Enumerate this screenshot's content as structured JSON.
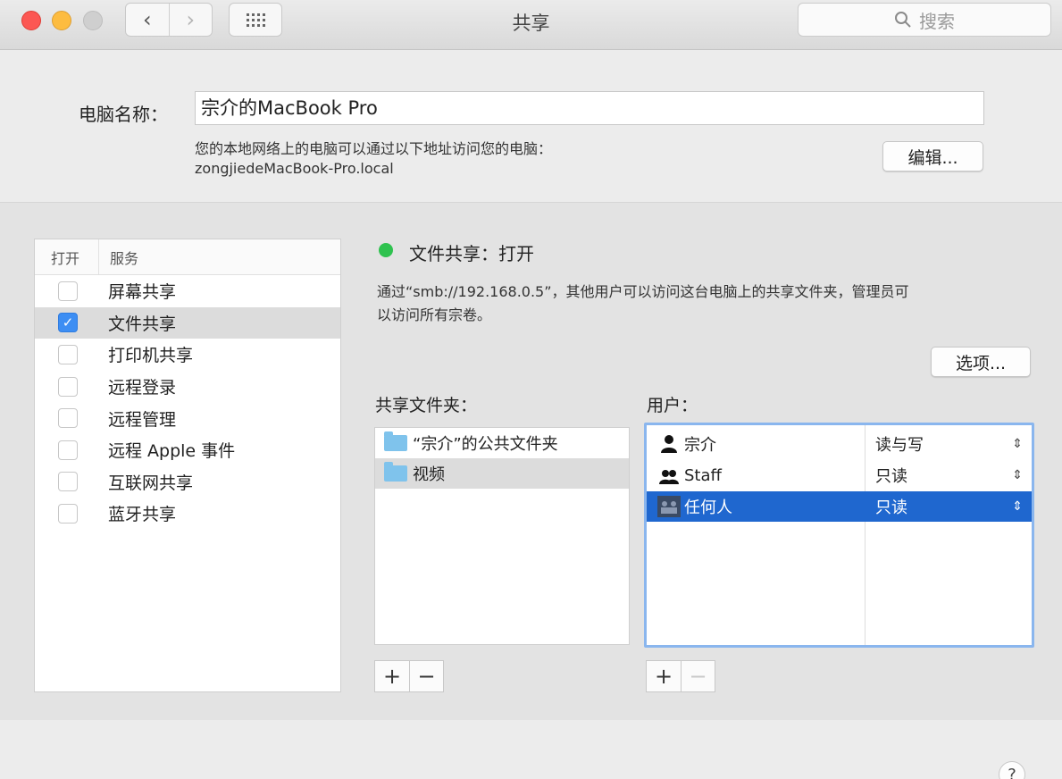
{
  "window": {
    "title": "共享"
  },
  "search": {
    "placeholder": "搜索"
  },
  "computer": {
    "label": "电脑名称：",
    "name": "宗介的MacBook Pro",
    "hint_line1": "您的本地网络上的电脑可以通过以下地址访问您的电脑：",
    "hint_line2": "zongjiedeMacBook-Pro.local",
    "edit_label": "编辑..."
  },
  "services": {
    "header_on": "打开",
    "header_service": "服务",
    "items": [
      {
        "label": "屏幕共享",
        "checked": false
      },
      {
        "label": "文件共享",
        "checked": true
      },
      {
        "label": "打印机共享",
        "checked": false
      },
      {
        "label": "远程登录",
        "checked": false
      },
      {
        "label": "远程管理",
        "checked": false
      },
      {
        "label": "远程 Apple 事件",
        "checked": false
      },
      {
        "label": "互联网共享",
        "checked": false
      },
      {
        "label": "蓝牙共享",
        "checked": false
      }
    ]
  },
  "detail": {
    "status": "文件共享：打开",
    "status_color": "#2fc24f",
    "desc_line1": "通过“smb://192.168.0.5”，其他用户可以访问这台电脑上的共享文件夹，管理员可",
    "desc_line2": "以访问所有宗卷。",
    "options_label": "选项...",
    "folders_label": "共享文件夹：",
    "users_label": "用户：",
    "folders": [
      {
        "name": "“宗介”的公共文件夹"
      },
      {
        "name": "视频"
      }
    ],
    "users": [
      {
        "name": "宗介",
        "permission": "读与写",
        "icon": "user-icon"
      },
      {
        "name": "Staff",
        "permission": "只读",
        "icon": "group-icon"
      },
      {
        "name": "任何人",
        "permission": "只读",
        "icon": "everyone-icon"
      }
    ]
  },
  "accent_color": "#1f67cf"
}
